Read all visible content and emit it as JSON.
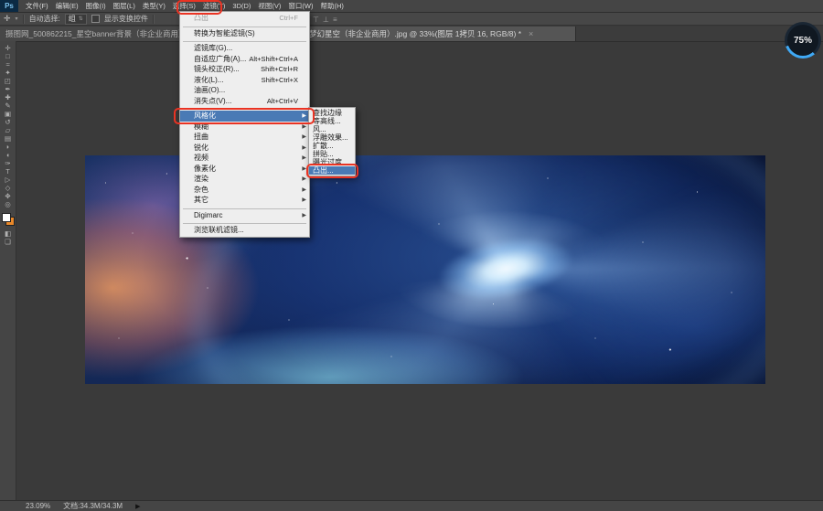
{
  "app": {
    "logo_text": "Ps",
    "badge_label": "75%"
  },
  "colors": {
    "annotation": "#ea3323",
    "menu_highlight": "#4a7ab5",
    "badge_ring": "#3fa9f5"
  },
  "menu_bar": {
    "items": [
      {
        "label": "文件(F)",
        "name": "menu-file"
      },
      {
        "label": "编辑(E)",
        "name": "menu-edit"
      },
      {
        "label": "图像(I)",
        "name": "menu-image"
      },
      {
        "label": "图层(L)",
        "name": "menu-layer"
      },
      {
        "label": "类型(Y)",
        "name": "menu-type"
      },
      {
        "label": "选择(S)",
        "name": "menu-select"
      },
      {
        "label": "滤镜(T)",
        "name": "menu-filter"
      },
      {
        "label": "3D(D)",
        "name": "menu-3d"
      },
      {
        "label": "视图(V)",
        "name": "menu-view"
      },
      {
        "label": "窗口(W)",
        "name": "menu-window"
      },
      {
        "label": "帮助(H)",
        "name": "menu-help"
      }
    ]
  },
  "options_bar": {
    "auto_select_label": "自动选择:",
    "auto_select_value": "组",
    "show_transform_label": "显示变换控件"
  },
  "tab_bar": {
    "tabs": [
      {
        "label": "摄图网_500862215_星空banner背景（非企业商用）"
      },
      {
        "label": "梦幻星空（非企业商用）.jpg @ 33%(图层 1拷贝 16, RGB/8) *",
        "close": "×"
      }
    ]
  },
  "filter_menu": {
    "items": [
      {
        "type": "item",
        "label": "凸出",
        "shortcut": "Ctrl+F",
        "disabled": true
      },
      {
        "type": "sep"
      },
      {
        "type": "item",
        "label": "转换为智能滤镜(S)"
      },
      {
        "type": "sep"
      },
      {
        "type": "item",
        "label": "滤镜库(G)..."
      },
      {
        "type": "item",
        "label": "自适应广角(A)...",
        "shortcut": "Alt+Shift+Ctrl+A"
      },
      {
        "type": "item",
        "label": "镜头校正(R)...",
        "shortcut": "Shift+Ctrl+R"
      },
      {
        "type": "item",
        "label": "液化(L)...",
        "shortcut": "Shift+Ctrl+X"
      },
      {
        "type": "item",
        "label": "油画(O)..."
      },
      {
        "type": "item",
        "label": "消失点(V)...",
        "shortcut": "Alt+Ctrl+V"
      },
      {
        "type": "sep"
      },
      {
        "type": "item",
        "label": "风格化",
        "submenu": true,
        "highlighted": true
      },
      {
        "type": "item",
        "label": "模糊",
        "submenu": true
      },
      {
        "type": "item",
        "label": "扭曲",
        "submenu": true
      },
      {
        "type": "item",
        "label": "锐化",
        "submenu": true
      },
      {
        "type": "item",
        "label": "视频",
        "submenu": true
      },
      {
        "type": "item",
        "label": "像素化",
        "submenu": true
      },
      {
        "type": "item",
        "label": "渲染",
        "submenu": true
      },
      {
        "type": "item",
        "label": "杂色",
        "submenu": true
      },
      {
        "type": "item",
        "label": "其它",
        "submenu": true
      },
      {
        "type": "sep"
      },
      {
        "type": "item",
        "label": "Digimarc",
        "submenu": true
      },
      {
        "type": "sep"
      },
      {
        "type": "item",
        "label": "浏览联机滤镜..."
      }
    ]
  },
  "stylize_submenu": {
    "items": [
      {
        "label": "查找边缘"
      },
      {
        "label": "等高线..."
      },
      {
        "label": "风..."
      },
      {
        "label": "浮雕效果..."
      },
      {
        "label": "扩散..."
      },
      {
        "label": "拼贴..."
      },
      {
        "label": "曝光过度"
      },
      {
        "label": "凸出...",
        "highlighted": true
      }
    ]
  },
  "toolbar": {
    "tools": [
      {
        "name": "move-tool",
        "glyph": "✛"
      },
      {
        "name": "marquee-tool",
        "glyph": "□"
      },
      {
        "name": "lasso-tool",
        "glyph": "≈"
      },
      {
        "name": "quick-selection-tool",
        "glyph": "✦"
      },
      {
        "name": "crop-tool",
        "glyph": "◰"
      },
      {
        "name": "eyedropper-tool",
        "glyph": "✒"
      },
      {
        "name": "healing-brush-tool",
        "glyph": "✚"
      },
      {
        "name": "brush-tool",
        "glyph": "✎"
      },
      {
        "name": "clone-stamp-tool",
        "glyph": "▣"
      },
      {
        "name": "history-brush-tool",
        "glyph": "↺"
      },
      {
        "name": "eraser-tool",
        "glyph": "▱"
      },
      {
        "name": "gradient-tool",
        "glyph": "▤"
      },
      {
        "name": "blur-tool",
        "glyph": "◗"
      },
      {
        "name": "dodge-tool",
        "glyph": "◖"
      },
      {
        "name": "pen-tool",
        "glyph": "✑"
      },
      {
        "name": "type-tool",
        "glyph": "T"
      },
      {
        "name": "path-selection-tool",
        "glyph": "▷"
      },
      {
        "name": "shape-tool",
        "glyph": "◇"
      },
      {
        "name": "hand-tool",
        "glyph": "✥"
      },
      {
        "name": "zoom-tool",
        "glyph": "◎"
      }
    ],
    "bottom_icons": [
      {
        "name": "quick-mask-icon",
        "glyph": "◧"
      },
      {
        "name": "screen-mode-icon",
        "glyph": "❏"
      }
    ],
    "swatches": {
      "foreground": "#ffffff",
      "background": "#e8882a"
    }
  },
  "status_bar": {
    "zoom": "23.09%",
    "doc_info": "文档:34.3M/34.3M",
    "arrow": "▶"
  }
}
